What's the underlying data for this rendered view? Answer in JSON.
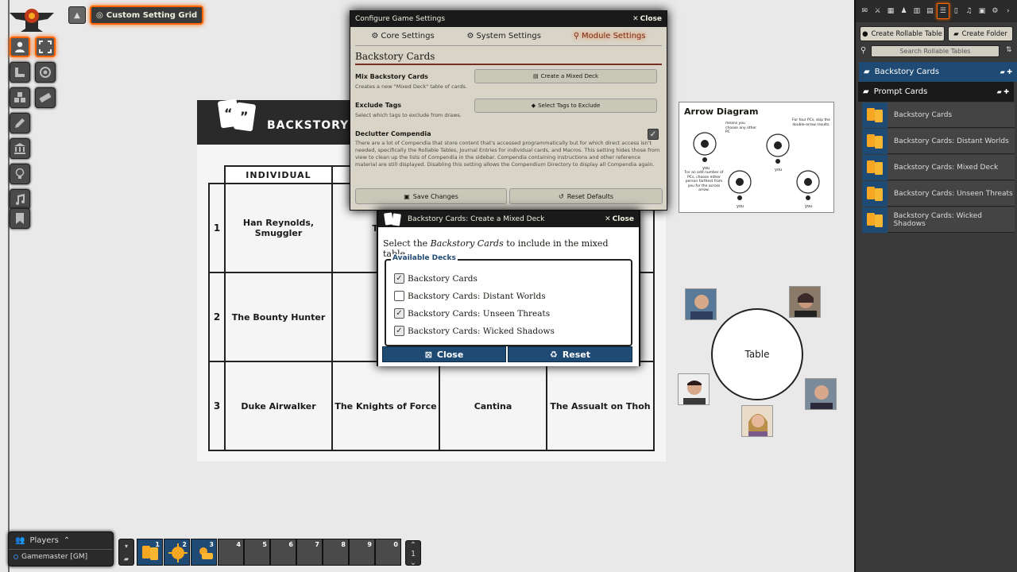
{
  "scene_nav": {
    "label": "Custom Setting Grid"
  },
  "board": {
    "title": "BACKSTORY C",
    "header": "INDIVIDUAL",
    "rows": [
      {
        "num": "1",
        "cells": [
          "Han Reynolds, Smuggler",
          "The F",
          "",
          "n"
        ]
      },
      {
        "num": "2",
        "cells": [
          "The Bounty Hunter",
          "Reb",
          "",
          ""
        ]
      },
      {
        "num": "3",
        "cells": [
          "Duke Airwalker",
          "The Knights of Force",
          "Cantina",
          "The Assualt on Thoh"
        ]
      }
    ]
  },
  "arrow_diagram": {
    "title": "Arrow Diagram",
    "note1": "means you choose any other PC",
    "note2": "For four PCs, skip the double-arrow results.",
    "note3": "For an odd number of PCs, choose either person farthest from you for the across arrow.",
    "you": "you"
  },
  "table_label": "Table",
  "settings": {
    "title": "Configure Game Settings",
    "close": "Close",
    "tabs": [
      "Core Settings",
      "System Settings",
      "Module Settings"
    ],
    "section": "Backstory Cards",
    "mix_label": "Mix Backstory Cards",
    "mix_button": "Create a Mixed Deck",
    "mix_hint": "Creates a new \"Mixed Deck\" table of cards.",
    "exclude_label": "Exclude Tags",
    "exclude_button": "Select Tags to Exclude",
    "exclude_hint": "Select which tags to exclude from draws.",
    "declutter_label": "Declutter Compendia",
    "declutter_hint": "There are a lot of Compendia that store content that's accessed programmatically but for which direct access isn't needed, specifically the Rollable Tables, Journal Entries for individual cards, and Macros. This setting hides those from view to clean up the lists of Compendia in the sidebar. Compendia containing instructions and other reference material are still displayed. Disabling this setting allows the Compendium Directory to display all Compendia again.",
    "save": "Save Changes",
    "reset": "Reset Defaults"
  },
  "mixed": {
    "title": "Backstory Cards: Create a Mixed Deck",
    "close": "Close",
    "intro_pre": "Select the ",
    "intro_em": "Backstory Cards",
    "intro_post": " to include in the mixed table.",
    "legend": "Available Decks",
    "decks": [
      {
        "label": "Backstory Cards",
        "checked": true
      },
      {
        "label": "Backstory Cards: Distant Worlds",
        "checked": false
      },
      {
        "label": "Backstory Cards: Unseen Threats",
        "checked": true
      },
      {
        "label": "Backstory Cards: Wicked Shadows",
        "checked": true
      }
    ],
    "close_btn": "Close",
    "reset_btn": "Reset"
  },
  "sidebar": {
    "create_table": "Create Rollable Table",
    "create_folder": "Create Folder",
    "search_placeholder": "Search Rollable Tables",
    "folder1": "Backstory Cards",
    "folder2": "Prompt Cards",
    "entries": [
      "Backstory Cards",
      "Backstory Cards: Distant Worlds",
      "Backstory Cards: Mixed Deck",
      "Backstory Cards: Unseen Threats",
      "Backstory Cards: Wicked Shadows"
    ]
  },
  "players": {
    "title": "Players",
    "gm": "Gamemaster [GM]"
  },
  "hotbar": {
    "slots": [
      "1",
      "2",
      "3",
      "4",
      "5",
      "6",
      "7",
      "8",
      "9",
      "0"
    ],
    "page": "1"
  },
  "colors": {
    "accent": "#ff6400",
    "blue": "#1e4a73",
    "module_tab": "#782e22"
  }
}
